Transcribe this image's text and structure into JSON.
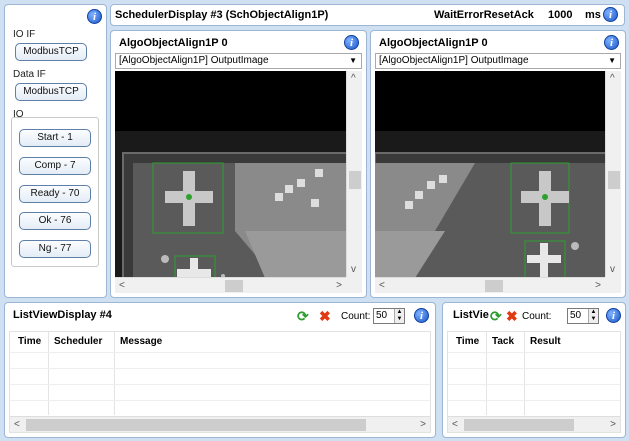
{
  "io_panel": {
    "io_if_label": "IO IF",
    "io_if_value": "ModbusTCP",
    "data_if_label": "Data IF",
    "data_if_value": "ModbusTCP",
    "io_label": "IO",
    "buttons": [
      "Start - 1",
      "Comp - 7",
      "Ready - 70",
      "Ok - 76",
      "Ng - 77"
    ]
  },
  "scheduler": {
    "title": "SchedulerDisplay #3 (SchObjectAlign1P)",
    "status": "WaitErrorResetAck",
    "time_value": "1000",
    "time_unit": "ms"
  },
  "displays": [
    {
      "title": "AlgoObjectAlign1P 0",
      "selected_output": "[AlgoObjectAlign1P] OutputImage"
    },
    {
      "title": "AlgoObjectAlign1P 0",
      "selected_output": "[AlgoObjectAlign1P] OutputImage"
    }
  ],
  "listviews": [
    {
      "title": "ListViewDisplay #4",
      "count_label": "Count:",
      "count_value": "50",
      "columns": [
        "Time",
        "Scheduler",
        "Message"
      ]
    },
    {
      "title": "ListVie",
      "count_label": "Count:",
      "count_value": "50",
      "columns": [
        "Time",
        "Tack",
        "Result"
      ]
    }
  ],
  "scroll": {
    "left": "<",
    "right": ">",
    "up": "^",
    "down": "v"
  },
  "icons": {
    "info": "info-icon",
    "refresh": "refresh-icon",
    "delete": "delete-icon",
    "dropdown": "chevron-down-icon"
  }
}
